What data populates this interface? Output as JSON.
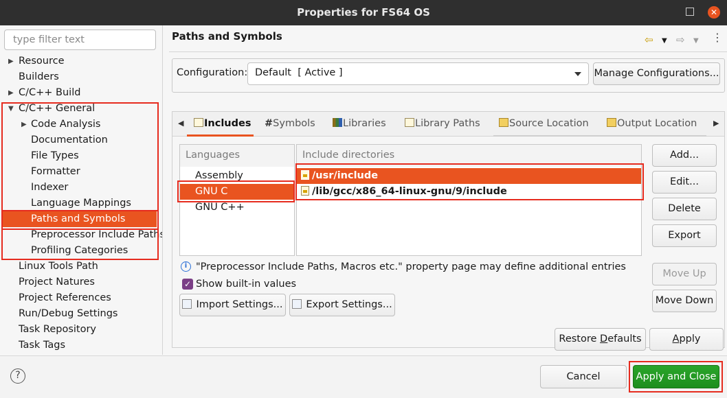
{
  "window": {
    "title": "Properties for FS64 OS"
  },
  "filter": {
    "placeholder": "type filter text"
  },
  "tree": {
    "items": [
      {
        "label": "Resource"
      },
      {
        "label": "Builders"
      },
      {
        "label": "C/C++ Build"
      },
      {
        "label": "C/C++ General"
      },
      {
        "label": "Code Analysis"
      },
      {
        "label": "Documentation"
      },
      {
        "label": "File Types"
      },
      {
        "label": "Formatter"
      },
      {
        "label": "Indexer"
      },
      {
        "label": "Language Mappings"
      },
      {
        "label": "Paths and Symbols"
      },
      {
        "label": "Preprocessor Include Paths"
      },
      {
        "label": "Profiling Categories"
      },
      {
        "label": "Linux Tools Path"
      },
      {
        "label": "Project Natures"
      },
      {
        "label": "Project References"
      },
      {
        "label": "Run/Debug Settings"
      },
      {
        "label": "Task Repository"
      },
      {
        "label": "Task Tags"
      }
    ]
  },
  "page": {
    "title": "Paths and Symbols"
  },
  "configuration": {
    "label": "Configuration:",
    "value": "Default  [ Active ]",
    "manage_label": "Manage Configurations..."
  },
  "tabs": [
    {
      "label": "Includes"
    },
    {
      "label": "Symbols"
    },
    {
      "label": "Libraries"
    },
    {
      "label": "Library Paths"
    },
    {
      "label": "Source Location"
    },
    {
      "label": "Output Location"
    }
  ],
  "languages": {
    "header": "Languages",
    "items": [
      {
        "label": "Assembly"
      },
      {
        "label": "GNU C"
      },
      {
        "label": "GNU C++"
      }
    ]
  },
  "includes": {
    "header": "Include directories",
    "items": [
      {
        "path": "/usr/include"
      },
      {
        "path": "/lib/gcc/x86_64-linux-gnu/9/include"
      }
    ]
  },
  "side_buttons": {
    "add": "Add...",
    "edit": "Edit...",
    "delete": "Delete",
    "export": "Export",
    "move_up": "Move Up",
    "move_down": "Move Down"
  },
  "info_text": "\"Preprocessor Include Paths, Macros etc.\" property page may define additional entries",
  "show_builtin": {
    "label": "Show built-in values",
    "checked": true
  },
  "settings_buttons": {
    "import": "Import Settings...",
    "export": "Export Settings..."
  },
  "footer": {
    "restore_defaults": {
      "before": "Restore ",
      "mnemonic": "D",
      "after": "efaults"
    },
    "apply": {
      "before": "",
      "mnemonic": "A",
      "after": "pply"
    },
    "cancel": "Cancel",
    "apply_and_close": "Apply and Close"
  },
  "colors": {
    "selection": "#e95420",
    "annotation": "#e62b1e",
    "apply_close": "#1f951f"
  }
}
